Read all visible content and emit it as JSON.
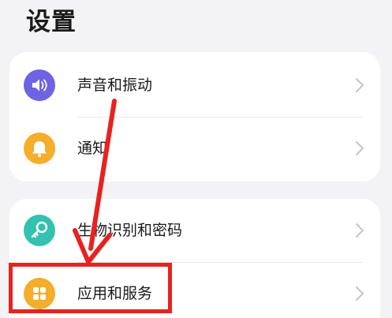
{
  "header": {
    "title": "设置"
  },
  "groups": [
    {
      "items": [
        {
          "label": "声音和振动",
          "icon": "speaker-icon",
          "color": "#6e63e0"
        },
        {
          "label": "通知",
          "icon": "bell-icon",
          "color": "#f5ad2c"
        }
      ]
    },
    {
      "items": [
        {
          "label": "生物识别和密码",
          "icon": "key-icon",
          "color": "#35c1b0"
        },
        {
          "label": "应用和服务",
          "icon": "apps-icon",
          "color": "#f5ad2c"
        }
      ]
    }
  ],
  "annotation": {
    "arrow_color": "#e8221f",
    "highlight_color": "#e8221f"
  }
}
